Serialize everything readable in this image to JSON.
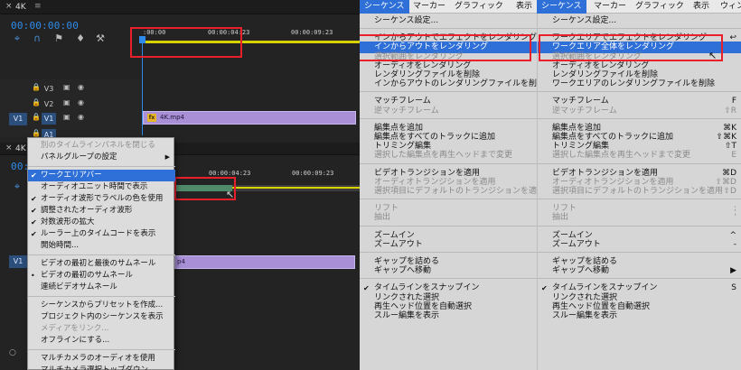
{
  "top_panel": {
    "title": "4K",
    "close": "×",
    "menu": "≡",
    "timecode": "00:00:00:00",
    "ruler": [
      ":00:00",
      "00:00:04:23",
      "00:00:09:23"
    ],
    "tracks": [
      "V3",
      "V2",
      "V1",
      "A1"
    ],
    "source_patch": "V1",
    "clip_label": "4K.mp4",
    "fx": "fx",
    "tool_icons": [
      "ripple-icon",
      "magnet-icon",
      "linked-icon",
      "marker-icon",
      "wrench-icon"
    ]
  },
  "bottom_panel": {
    "title": "4K",
    "close": "×",
    "timecode": "00:00:00:00",
    "ruler": [
      "00:00:04:23",
      "00:00:09:23"
    ],
    "source_patch": "V1",
    "clip_label": "p4",
    "track_icon": "A1",
    "track_icons": [
      "M",
      "S",
      "🎤"
    ],
    "cursor": "↖",
    "bottom_ctrl": "○"
  },
  "context_menu": {
    "items": [
      {
        "label": "別のタイムラインパネルを閉じる",
        "disabled": true
      },
      {
        "label": "パネルグループの設定",
        "submenu": "▶"
      },
      {
        "sep": true
      },
      {
        "label": "ワークエリアバー",
        "checked": "✔",
        "highlight": true
      },
      {
        "label": "オーディオユニット時間で表示"
      },
      {
        "label": "オーディオ波形でラベルの色を使用",
        "checked": "✔"
      },
      {
        "label": "調整されたオーディオ波形",
        "checked": "✔"
      },
      {
        "label": "対数波形の拡大",
        "checked": "✔"
      },
      {
        "label": "ルーラー上のタイムコードを表示",
        "checked": "✔"
      },
      {
        "label": "開始時間..."
      },
      {
        "sep": true
      },
      {
        "label": "ビデオの最初と最後のサムネール"
      },
      {
        "label": "ビデオの最初のサムネール",
        "checked": "•"
      },
      {
        "label": "連続ビデオサムネール"
      },
      {
        "sep": true
      },
      {
        "label": "シーケンスからプリセットを作成..."
      },
      {
        "label": "プロジェクト内のシーケンスを表示"
      },
      {
        "label": "メディアをリンク...",
        "disabled": true
      },
      {
        "label": "オフラインにする..."
      },
      {
        "sep": true
      },
      {
        "label": "マルチカメラのオーディオを使用"
      },
      {
        "label": "マルチカメラ選択トップダウン"
      }
    ]
  },
  "menubar": {
    "items": [
      {
        "label": "シーケンス",
        "active": true
      },
      {
        "label": "マーカー"
      },
      {
        "label": "グラフィック"
      },
      {
        "label": "表示"
      },
      {
        "label": "シーケンス",
        "active": true
      },
      {
        "label": "マーカー"
      },
      {
        "label": "グラフィック"
      },
      {
        "label": "表示"
      },
      {
        "label": "ウィン"
      }
    ]
  },
  "seq_menu_left": {
    "items": [
      {
        "label": "シーケンス設定..."
      },
      {
        "sep": true
      },
      {
        "label": "インからアウトでエフェクトをレンダリング"
      },
      {
        "label": "インからアウトをレンダリング",
        "highlight": true
      },
      {
        "label": "選択範囲をレンダリング",
        "disabled": true
      },
      {
        "label": "オーディオをレンダリング"
      },
      {
        "label": "レンダリングファイルを削除"
      },
      {
        "label": "インからアウトのレンダリングファイルを削除"
      },
      {
        "sep": true
      },
      {
        "label": "マッチフレーム"
      },
      {
        "label": "逆マッチフレーム",
        "disabled": true
      },
      {
        "sep": true
      },
      {
        "label": "編集点を追加"
      },
      {
        "label": "編集点をすべてのトラックに追加"
      },
      {
        "label": "トリミング編集"
      },
      {
        "label": "選択した編集点を再生ヘッドまで変更",
        "disabled": true
      },
      {
        "sep": true
      },
      {
        "label": "ビデオトランジションを適用"
      },
      {
        "label": "オーディオトランジションを適用",
        "disabled": true
      },
      {
        "label": "選択項目にデフォルトのトランジションを適用",
        "disabled": true
      },
      {
        "sep": true
      },
      {
        "label": "リフト",
        "disabled": true
      },
      {
        "label": "抽出",
        "disabled": true
      },
      {
        "sep": true
      },
      {
        "label": "ズームイン"
      },
      {
        "label": "ズームアウト"
      },
      {
        "sep": true
      },
      {
        "label": "ギャップを詰める"
      },
      {
        "label": "ギャップへ移動"
      },
      {
        "sep": true
      },
      {
        "label": "タイムラインをスナップイン",
        "checked": "✔"
      },
      {
        "label": "リンクされた選択"
      },
      {
        "label": "再生ヘッド位置を自動選択"
      },
      {
        "label": "スルー編集を表示"
      }
    ]
  },
  "seq_menu_right": {
    "items": [
      {
        "label": "シーケンス設定..."
      },
      {
        "sep": true
      },
      {
        "label": "ワークエリアでエフェクトをレンダリング",
        "shortcut": "↩"
      },
      {
        "label": "ワークエリア全体をレンダリング",
        "highlight": true
      },
      {
        "label": "選択範囲をレンダリング",
        "disabled": true
      },
      {
        "label": "オーディオをレンダリング"
      },
      {
        "label": "レンダリングファイルを削除"
      },
      {
        "label": "ワークエリアのレンダリングファイルを削除"
      },
      {
        "sep": true
      },
      {
        "label": "マッチフレーム",
        "shortcut": "F"
      },
      {
        "label": "逆マッチフレーム",
        "disabled": true,
        "shortcut": "⇧R"
      },
      {
        "sep": true
      },
      {
        "label": "編集点を追加",
        "shortcut": "⌘K"
      },
      {
        "label": "編集点をすべてのトラックに追加",
        "shortcut": "⇧⌘K"
      },
      {
        "label": "トリミング編集",
        "shortcut": "⇧T"
      },
      {
        "label": "選択した編集点を再生ヘッドまで変更",
        "disabled": true,
        "shortcut": "E"
      },
      {
        "sep": true
      },
      {
        "label": "ビデオトランジションを適用",
        "shortcut": "⌘D"
      },
      {
        "label": "オーディオトランジションを適用",
        "disabled": true,
        "shortcut": "⇧⌘D"
      },
      {
        "label": "選択項目にデフォルトのトランジションを適用",
        "disabled": true,
        "shortcut": "⇧D"
      },
      {
        "sep": true
      },
      {
        "label": "リフト",
        "disabled": true,
        "shortcut": ";"
      },
      {
        "label": "抽出",
        "disabled": true,
        "shortcut": "'"
      },
      {
        "sep": true
      },
      {
        "label": "ズームイン",
        "shortcut": "^"
      },
      {
        "label": "ズームアウト",
        "shortcut": "-"
      },
      {
        "sep": true
      },
      {
        "label": "ギャップを詰める"
      },
      {
        "label": "ギャップへ移動",
        "shortcut": "▶"
      },
      {
        "sep": true
      },
      {
        "label": "タイムラインをスナップイン",
        "checked": "✔",
        "shortcut": "S"
      },
      {
        "label": "リンクされた選択"
      },
      {
        "label": "再生ヘッド位置を自動選択"
      },
      {
        "label": "スルー編集を表示"
      }
    ]
  },
  "colors": {
    "highlight": "#2e6fd8",
    "timecode": "#2d8ceb",
    "work_area_bar": "#d8d200",
    "clip": "#a88fd6",
    "annotation_box": "#e8202a"
  }
}
